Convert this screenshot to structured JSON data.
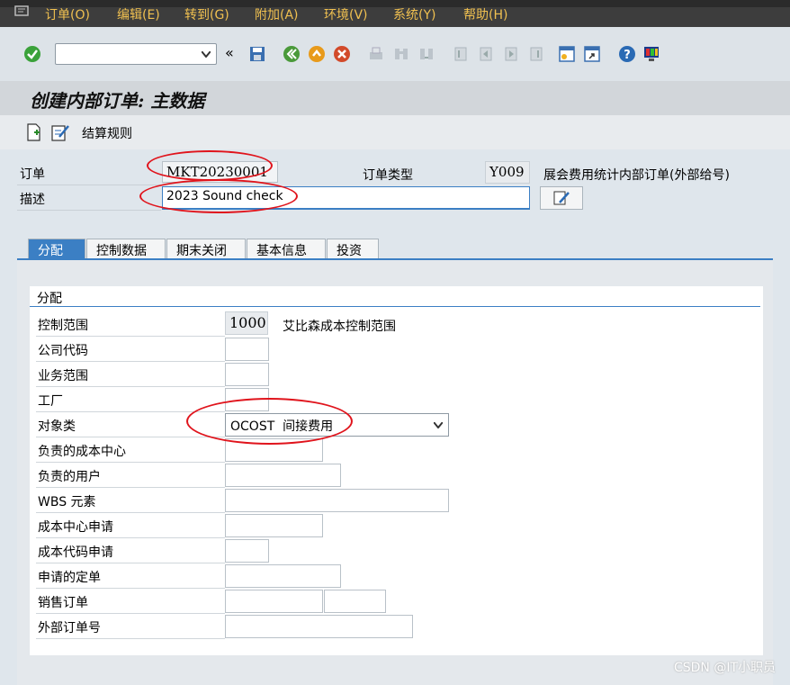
{
  "menu": [
    "订单(O)",
    "编辑(E)",
    "转到(G)",
    "附加(A)",
    "环境(V)",
    "系统(Y)",
    "帮助(H)"
  ],
  "toolbar": {
    "command_value": "",
    "back_chevron": "«"
  },
  "title": "创建内部订单: 主数据",
  "app_toolbar": {
    "settlement_rule": "结算规则"
  },
  "header": {
    "order_label": "订单",
    "order_value": "MKT20230001",
    "order_type_label": "订单类型",
    "order_type_value": "Y009",
    "order_type_desc": "展会费用统计内部订单(外部给号)",
    "desc_label": "描述",
    "desc_value": "2023 Sound check"
  },
  "tabs": [
    "分配",
    "控制数据",
    "期末关闭",
    "基本信息",
    "投资"
  ],
  "group": {
    "title": "分配",
    "rows": [
      {
        "label": "控制范围",
        "value": "1000",
        "desc": "艾比森成本控制范围"
      },
      {
        "label": "公司代码",
        "value": ""
      },
      {
        "label": "业务范围",
        "value": ""
      },
      {
        "label": "工厂",
        "value": ""
      },
      {
        "label": "对象类",
        "value": "OCOST  间接费用"
      },
      {
        "label": "负责的成本中心",
        "value": ""
      },
      {
        "label": "负责的用户",
        "value": ""
      },
      {
        "label": "WBS 元素",
        "value": ""
      },
      {
        "label": "成本中心申请",
        "value": ""
      },
      {
        "label": "成本代码申请",
        "value": ""
      },
      {
        "label": "申请的定单",
        "value": ""
      },
      {
        "label": "销售订单",
        "value": ""
      },
      {
        "label": "外部订单号",
        "value": ""
      }
    ]
  },
  "watermark": "CSDN @IT小职员",
  "colors": {
    "menu_bg": "#3d3d3d",
    "menu_text": "#f0c050",
    "tab_active": "#3b7fc4",
    "annotation": "#e0141c"
  }
}
